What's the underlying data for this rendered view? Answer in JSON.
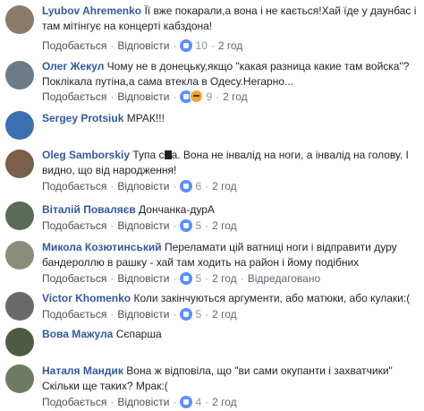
{
  "actions": {
    "like": "Подобається",
    "reply": "Відповісти"
  },
  "comments": [
    {
      "author": "Lyubov Ahremenko",
      "text": "Її вже покарали,а вона і не кається!Хай їде у даунбас і там мітінгує на концерті кабздона!",
      "reactions": "10",
      "time": "2 год",
      "avatar_color": "#8a7a6a",
      "icons": [
        "like"
      ]
    },
    {
      "author": "Олег Жекул",
      "text": "Чому не в донецьку,якщо \"какая разница какие там войска\"? Поклікала путіна,а сама втекла в Одесу.Негарно...",
      "reactions": "9",
      "time": "2 год",
      "avatar_color": "#6c7a86",
      "icons": [
        "like",
        "angry"
      ]
    },
    {
      "author": "Sergey Protsiuk",
      "text": "МРАК!!!",
      "avatar_color": "#3b6fb0"
    },
    {
      "author": "Oleg Samborskiy",
      "text_a": "Тупа с",
      "text_b": "а. Вона не інвалід на ноги, а інвалід на голову. І видно, що від народження!",
      "reactions": "6",
      "time": "2 год",
      "avatar_color": "#7a5f4a",
      "icons": [
        "like"
      ]
    },
    {
      "author": "Віталій Поваляєв",
      "text": "Дончанка-дурА",
      "reactions": "5",
      "time": "2 год",
      "avatar_color": "#5d6a58",
      "icons": [
        "like"
      ]
    },
    {
      "author": "Микола Козютинський",
      "text": "Переламати цій ватниці ноги і відправити дуру бандероллю в рашку - хай там ходить на район і йому подібних",
      "reactions": "5",
      "time": "2 год",
      "edited": "Відредаговано",
      "avatar_color": "#8c8c7a",
      "icons": [
        "like"
      ]
    },
    {
      "author": "Victor Khomenko",
      "text": "Коли закінчуються аргументи, або матюки, або кулаки:(",
      "reactions": "5",
      "time": "2 год",
      "avatar_color": "#6a6a6a",
      "icons": [
        "like"
      ]
    },
    {
      "author": "Вова Мажула",
      "text": "Сєпарша",
      "avatar_color": "#4f5b44"
    },
    {
      "author": "Наталя Мандик",
      "text": "Вона ж відповіла, що \"ви сами окупанти і захватчики\" Скільки ще таких? Мрак:(",
      "reactions": "4",
      "time": "2 год",
      "avatar_color": "#6e7b62",
      "icons": [
        "like"
      ]
    }
  ]
}
